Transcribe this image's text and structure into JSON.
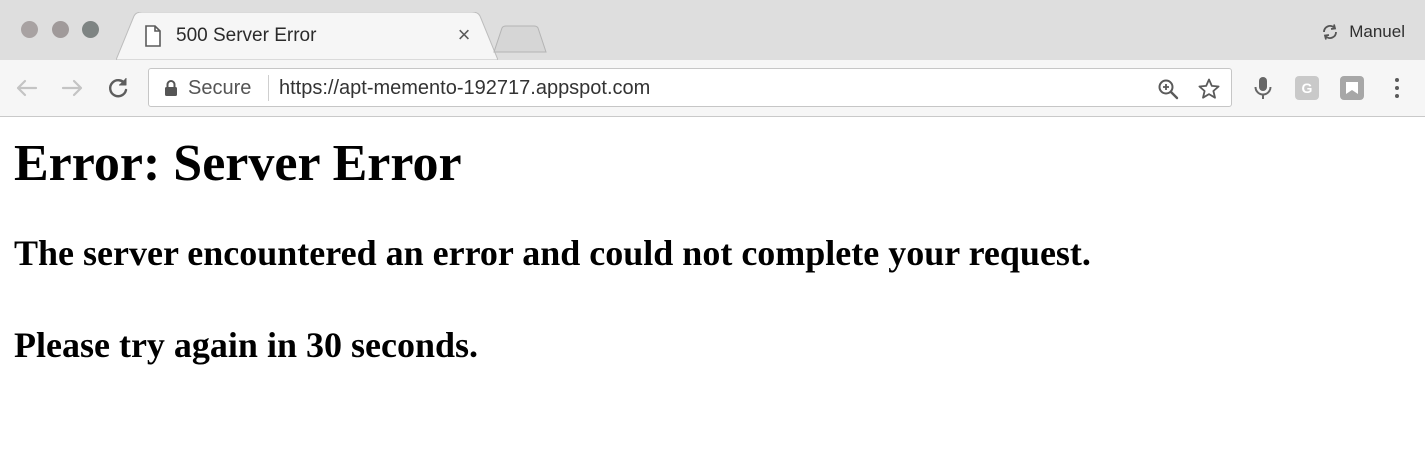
{
  "window": {
    "profile_name": "Manuel"
  },
  "tab": {
    "title": "500 Server Error",
    "close_glyph": "×"
  },
  "toolbar": {
    "secure_label": "Secure",
    "url": "https://apt-memento-192717.appspot.com",
    "extension_g_label": "G"
  },
  "page": {
    "heading": "Error: Server Error",
    "message": "The server encountered an error and could not complete your request.",
    "retry_message": "Please try again in 30 seconds."
  },
  "icons": {
    "back": "back-arrow-icon",
    "forward": "forward-arrow-icon",
    "reload": "reload-icon",
    "lock": "lock-icon",
    "zoom": "zoom-icon",
    "bookmark": "star-icon",
    "mic": "microphone-icon",
    "menu": "kebab-menu-icon",
    "sync": "sync-icon"
  },
  "colors": {
    "chrome_frame": "#dedede",
    "toolbar": "#f6f6f6",
    "page_background": "#ffffff",
    "page_text": "#000000"
  }
}
